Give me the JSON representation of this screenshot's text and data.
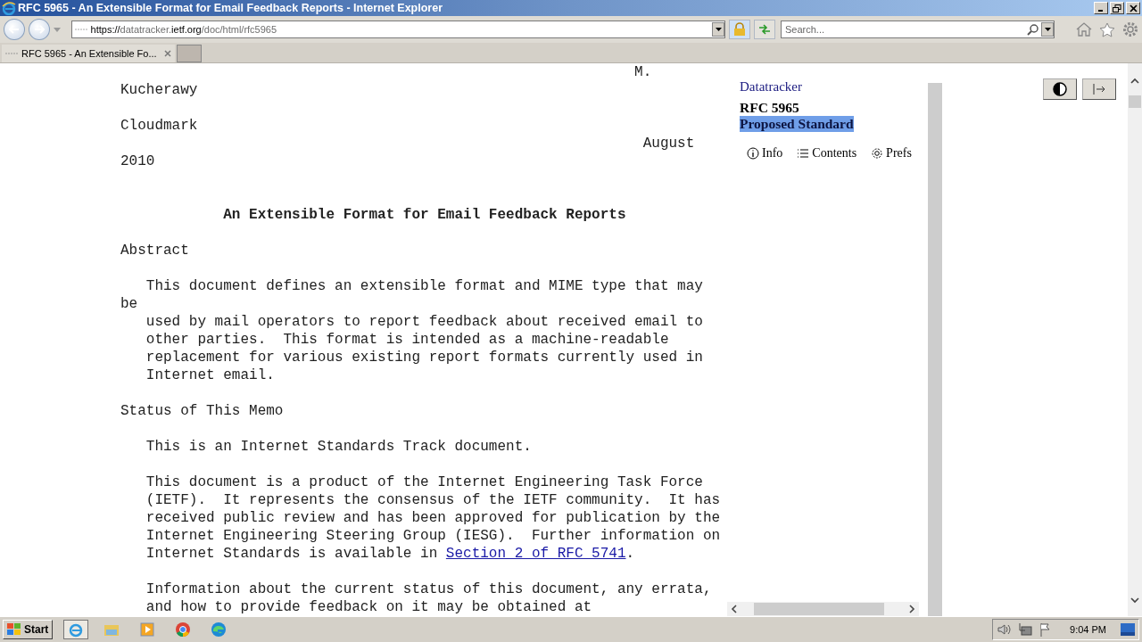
{
  "window": {
    "title": "RFC 5965 - An Extensible Format for Email Feedback Reports - Internet Explorer"
  },
  "address_bar": {
    "scheme": "https://",
    "host_prefix": "datatracker.",
    "host": "ietf.org",
    "path": "/doc/html/rfc5965"
  },
  "search": {
    "placeholder": "Search..."
  },
  "tabs": [
    {
      "label": "RFC 5965 - An Extensible Fo...",
      "selected": true
    }
  ],
  "document": {
    "lines": [
      {
        "text": "                                                            M."
      },
      {
        "text": "Kucherawy"
      },
      {
        "kind": "blank"
      },
      {
        "text": "Cloudmark"
      },
      {
        "text": "                                                             August"
      },
      {
        "text": "2010"
      },
      {
        "kind": "blank"
      },
      {
        "kind": "blank"
      },
      {
        "kind": "title",
        "text": "            An Extensible Format for Email Feedback Reports"
      },
      {
        "kind": "blank"
      },
      {
        "text": "Abstract"
      },
      {
        "kind": "blank"
      },
      {
        "text": "   This document defines an extensible format and MIME type that may"
      },
      {
        "text": "be"
      },
      {
        "text": "   used by mail operators to report feedback about received email to"
      },
      {
        "text": "   other parties.  This format is intended as a machine-readable"
      },
      {
        "text": "   replacement for various existing report formats currently used in"
      },
      {
        "text": "   Internet email."
      },
      {
        "kind": "blank"
      },
      {
        "text": "Status of This Memo"
      },
      {
        "kind": "blank"
      },
      {
        "text": "   This is an Internet Standards Track document."
      },
      {
        "kind": "blank"
      },
      {
        "text": "   This document is a product of the Internet Engineering Task Force"
      },
      {
        "text": "   (IETF).  It represents the consensus of the IETF community.  It has"
      },
      {
        "text": "   received public review and has been approved for publication by the"
      },
      {
        "text": "   Internet Engineering Steering Group (IESG).  Further information on"
      },
      {
        "kind": "link",
        "text": "   Internet Standards is available in ",
        "link": "Section 2 of RFC 5741",
        "after": "."
      },
      {
        "kind": "blank"
      },
      {
        "text": "   Information about the current status of this document, any errata,"
      },
      {
        "text": "   and how to provide feedback on it may be obtained at"
      }
    ]
  },
  "sidebar": {
    "site": "Datatracker",
    "rfc": "RFC 5965",
    "status": "Proposed Standard",
    "status_highlighted": true,
    "links": [
      {
        "kind": "info",
        "label": "Info"
      },
      {
        "kind": "contents",
        "label": "Contents"
      },
      {
        "kind": "prefs",
        "label": "Prefs"
      }
    ]
  },
  "taskbar": {
    "start": "Start",
    "clock": "9:04 PM"
  }
}
